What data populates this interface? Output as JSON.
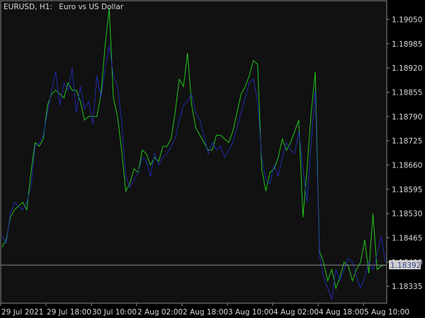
{
  "window": {
    "symbol_label": "EURUSD, H1:",
    "symbol_description": "Euro vs US Dollar"
  },
  "colors": {
    "background": "#000000",
    "plot_background": "#111111",
    "axis_text": "#d9d9d9",
    "frame": "#8a8a8a",
    "green_series": "#22c71b",
    "blue_series": "#1f2ba8",
    "price_line": "#8a8a8a",
    "price_label_bg": "#cfcfcf",
    "price_label_text": "#3a4a8a"
  },
  "chart_data": {
    "type": "line",
    "y_ticks": [
      "1.19050",
      "1.18985",
      "1.18920",
      "1.18855",
      "1.18790",
      "1.18725",
      "1.18660",
      "1.18595",
      "1.18530",
      "1.18465",
      "1.18400",
      "1.18335"
    ],
    "y_tick_values": [
      1.1905,
      1.18985,
      1.1892,
      1.18855,
      1.1879,
      1.18725,
      1.1866,
      1.18595,
      1.1853,
      1.18465,
      1.184,
      1.18335
    ],
    "ylim": [
      1.1829,
      1.191
    ],
    "x_ticks": [
      "29 Jul 2021",
      "29 Jul 18:00",
      "30 Jul 10:00",
      "2 Aug 02:00",
      "2 Aug 18:00",
      "3 Aug 10:00",
      "4 Aug 02:00",
      "4 Aug 18:00",
      "5 Aug 10:00"
    ],
    "current_price": "1.18392",
    "current_price_value": 1.18392,
    "series": [
      {
        "color": "#22c71b",
        "values": [
          1.1844,
          1.1846,
          1.1852,
          1.1854,
          1.1855,
          1.1856,
          1.1854,
          1.1864,
          1.1872,
          1.1871,
          1.1873,
          1.1882,
          1.1885,
          1.1886,
          1.1885,
          1.1884,
          1.1888,
          1.1886,
          1.1886,
          1.1883,
          1.1878,
          1.1879,
          1.1879,
          1.1879,
          1.1885,
          1.1898,
          1.1908,
          1.1884,
          1.1879,
          1.187,
          1.1859,
          1.1861,
          1.1865,
          1.1864,
          1.187,
          1.1869,
          1.1866,
          1.1868,
          1.1867,
          1.1871,
          1.1871,
          1.1873,
          1.188,
          1.1889,
          1.1887,
          1.1896,
          1.1882,
          1.1876,
          1.1874,
          1.1872,
          1.187,
          1.187,
          1.1874,
          1.1874,
          1.1873,
          1.1872,
          1.1875,
          1.188,
          1.1885,
          1.1887,
          1.189,
          1.1894,
          1.1893,
          1.1865,
          1.1859,
          1.1864,
          1.1865,
          1.1868,
          1.1873,
          1.187,
          1.1872,
          1.1875,
          1.1878,
          1.1852,
          1.1865,
          1.188,
          1.1891,
          1.1843,
          1.184,
          1.1835,
          1.1838,
          1.1833,
          1.1836,
          1.184,
          1.1839,
          1.1835,
          1.1838,
          1.184,
          1.1846,
          1.1837,
          1.1853,
          1.1838,
          1.1839,
          1.18392
        ]
      },
      {
        "color": "#1f2ba8",
        "values": [
          1.1847,
          1.1845,
          1.1853,
          1.1856,
          1.1855,
          1.1854,
          1.1856,
          1.186,
          1.1871,
          1.1872,
          1.1874,
          1.188,
          1.1886,
          1.1891,
          1.1882,
          1.1888,
          1.1886,
          1.1892,
          1.188,
          1.1887,
          1.1881,
          1.1883,
          1.1877,
          1.189,
          1.1884,
          1.1892,
          1.1898,
          1.189,
          1.1887,
          1.1878,
          1.1863,
          1.186,
          1.1862,
          1.1864,
          1.1868,
          1.1867,
          1.1863,
          1.1869,
          1.1866,
          1.1868,
          1.1869,
          1.1871,
          1.1873,
          1.1878,
          1.1882,
          1.1883,
          1.1885,
          1.188,
          1.1878,
          1.1874,
          1.1869,
          1.1872,
          1.187,
          1.1871,
          1.1868,
          1.187,
          1.1872,
          1.1876,
          1.188,
          1.1884,
          1.1888,
          1.1889,
          1.1883,
          1.1868,
          1.1862,
          1.1861,
          1.1866,
          1.1863,
          1.1868,
          1.1872,
          1.187,
          1.1869,
          1.1875,
          1.1865,
          1.1856,
          1.1872,
          1.1886,
          1.1842,
          1.1836,
          1.1833,
          1.183,
          1.1838,
          1.1835,
          1.1838,
          1.1841,
          1.184,
          1.1836,
          1.1833,
          1.1836,
          1.184,
          1.1838,
          1.1842,
          1.1847,
          1.184
        ]
      }
    ]
  }
}
